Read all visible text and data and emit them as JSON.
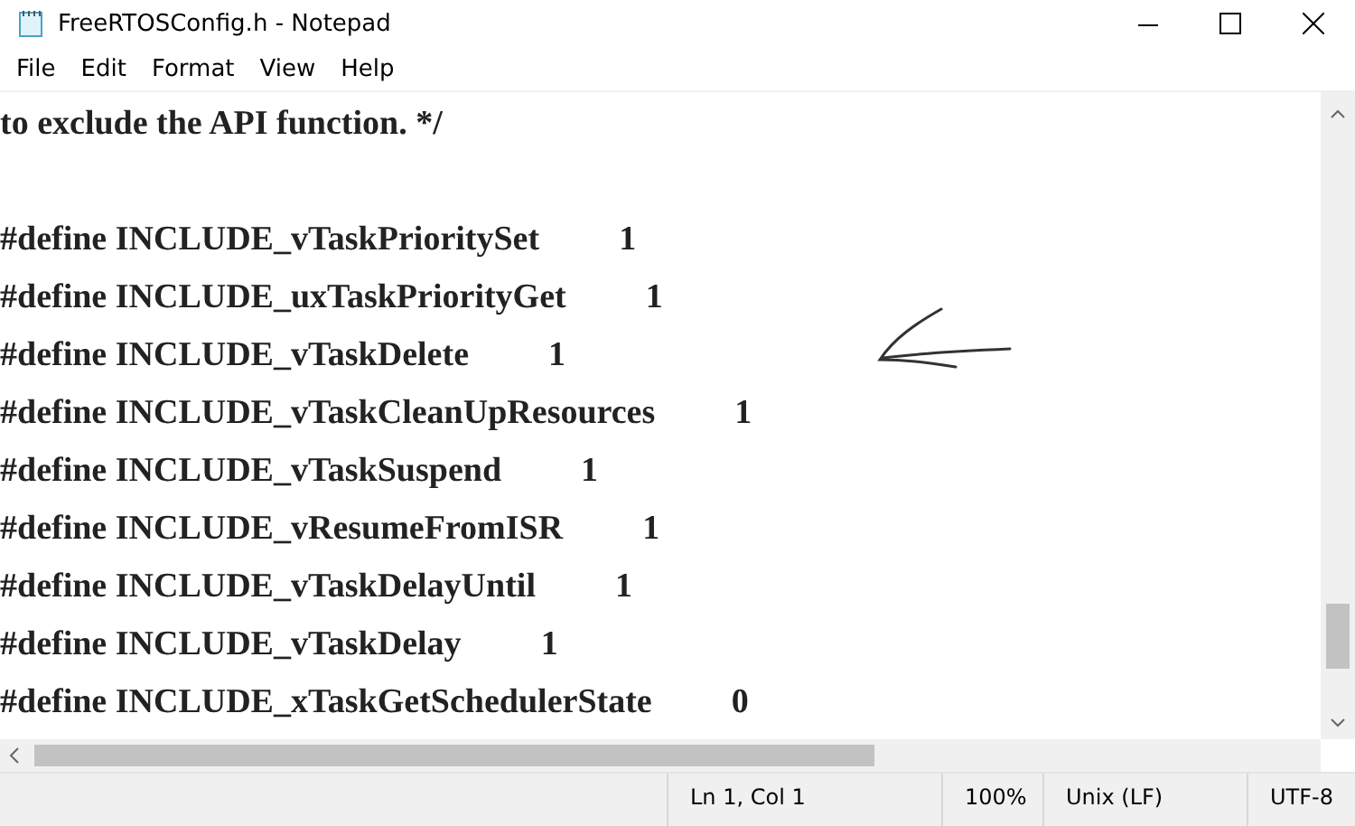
{
  "window": {
    "title": "FreeRTOSConfig.h - Notepad"
  },
  "menu": [
    "File",
    "Edit",
    "Format",
    "View",
    "Help"
  ],
  "comment": "to exclude the API function. */",
  "lines": [
    {
      "text": "#define INCLUDE_vTaskPrioritySet",
      "value": "1"
    },
    {
      "text": "#define INCLUDE_uxTaskPriorityGet",
      "value": "1"
    },
    {
      "text": "#define INCLUDE_vTaskDelete",
      "value": "1"
    },
    {
      "text": "#define INCLUDE_vTaskCleanUpResources",
      "value": "1"
    },
    {
      "text": "#define INCLUDE_vTaskSuspend",
      "value": "1"
    },
    {
      "text": "#define INCLUDE_vResumeFromISR",
      "value": "1"
    },
    {
      "text": "#define INCLUDE_vTaskDelayUntil",
      "value": "1"
    },
    {
      "text": "#define INCLUDE_vTaskDelay",
      "value": "1"
    },
    {
      "text": "#define INCLUDE_xTaskGetSchedulerState",
      "value": "0"
    }
  ],
  "status_bar": [
    "Ln 1, Col 1",
    "100%",
    "Unix (LF)",
    "UTF-8"
  ]
}
